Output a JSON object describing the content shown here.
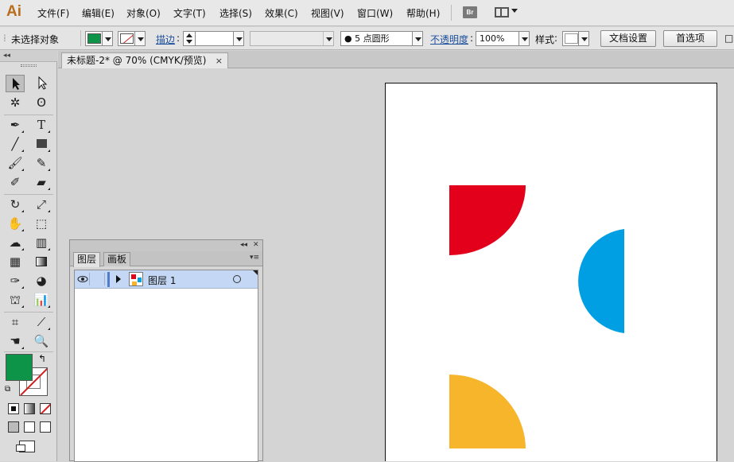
{
  "app": {
    "logo": "Ai"
  },
  "menu": {
    "items": [
      "文件(F)",
      "编辑(E)",
      "对象(O)",
      "文字(T)",
      "选择(S)",
      "效果(C)",
      "视图(V)",
      "窗口(W)",
      "帮助(H)"
    ],
    "bridge_label": "Br"
  },
  "control": {
    "no_selection": "未选择对象",
    "fill_color": "#0d9448",
    "stroke_label": "描边",
    "stroke_value": "",
    "brush_value": "",
    "point_style": "● 5 点圆形",
    "opacity_label": "不透明度",
    "opacity_value": "100%",
    "style_label": "样式",
    "doc_setup_button": "文档设置",
    "prefs_button": "首选项",
    "extra_glyph": "□"
  },
  "document": {
    "tab_title": "未标题-2* @ 70% (CMYK/预览)",
    "close": "×"
  },
  "tools": {
    "icons": [
      "selection-icon",
      "direct-selection-icon",
      "magic-wand-icon",
      "lasso-icon",
      "pen-icon",
      "type-icon",
      "line-icon",
      "rectangle-icon",
      "paintbrush-icon",
      "pencil-icon",
      "blob-brush-icon",
      "eraser-icon",
      "rotate-icon",
      "scale-icon",
      "warp-icon",
      "free-transform-icon",
      "shape-builder-icon",
      "graph-icon",
      "mesh-icon",
      "gradient-icon",
      "eyedropper-icon",
      "blend-icon",
      "symbol-sprayer-icon",
      "column-graph-icon",
      "artboard-icon",
      "slice-icon",
      "hand-icon",
      "zoom-icon"
    ]
  },
  "colors": {
    "fill": "#0d9448",
    "stroke_none": "#d21f1f",
    "red_shape": "#e2001a",
    "blue_shape": "#009fe3",
    "yellow_shape": "#f7b52c"
  },
  "layers_panel": {
    "tab_layers": "图层",
    "tab_artboards": "画板",
    "collapse": "◂◂",
    "close": "✕",
    "menu": "▾≡",
    "layer_name": "图层 1",
    "eye": "👁"
  }
}
